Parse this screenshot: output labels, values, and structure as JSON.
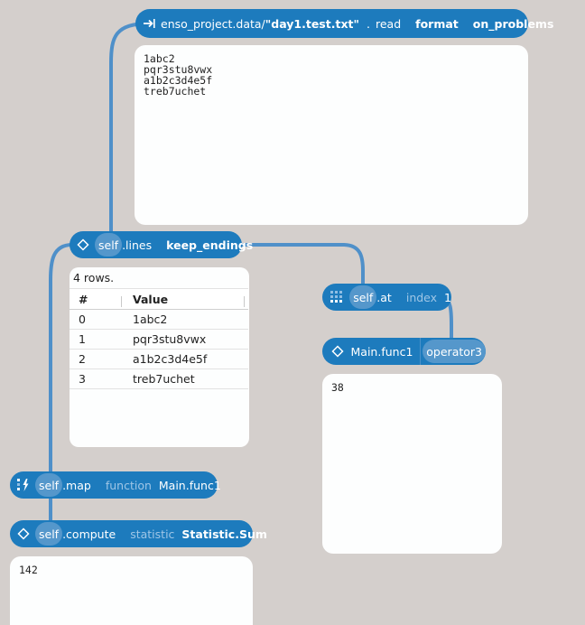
{
  "read_node": {
    "prefix": "enso_project.data/",
    "path": "\"day1.test.txt\"",
    "dot": ".",
    "method": "read",
    "arg1": "format",
    "arg2": "on_problems"
  },
  "read_output": {
    "text": "1abc2\npqr3stu8vwx\na1b2c3d4e5f\ntreb7uchet"
  },
  "lines_node": {
    "self": "self",
    "method": ".lines",
    "arg": "keep_endings"
  },
  "lines_table": {
    "caption": "4 rows.",
    "headers": [
      "#",
      "Value"
    ],
    "rows": [
      {
        "index": "0",
        "value": "1abc2"
      },
      {
        "index": "1",
        "value": "pqr3stu8vwx"
      },
      {
        "index": "2",
        "value": "a1b2c3d4e5f"
      },
      {
        "index": "3",
        "value": "treb7uchet"
      }
    ]
  },
  "at_node": {
    "self": "self",
    "method": ".at",
    "arg_name": "index",
    "arg_value": "1"
  },
  "func1_node": {
    "label": "Main.func1",
    "arg": "operator3"
  },
  "func1_output": {
    "text": "38"
  },
  "map_node": {
    "self": "self",
    "method": ".map",
    "arg_name": "function",
    "arg_value": "Main.func1"
  },
  "compute_node": {
    "self": "self",
    "method": ".compute",
    "arg_name": "statistic",
    "arg_value": "Statistic.Sum"
  },
  "compute_output": {
    "text": "142"
  },
  "icons": {
    "read": "input-arrow-icon",
    "lines": "diamond-icon",
    "at": "grid-icon",
    "func1": "diamond-icon",
    "map": "map-icon",
    "compute": "diamond-icon"
  },
  "colors": {
    "background": "#d4cfcc",
    "node": "#1d7bbd",
    "self_chip": "#5597cb",
    "edge": "#4f90c9",
    "panel": "#fdfefe"
  }
}
